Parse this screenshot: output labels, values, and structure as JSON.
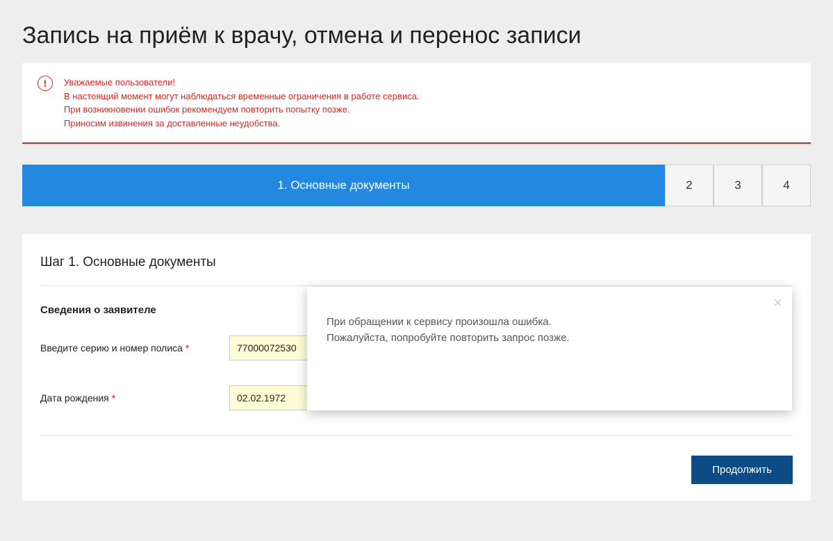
{
  "title": "Запись на приём к врачу, отмена и перенос записи",
  "warning": {
    "line1": "Уважаемые пользователи!",
    "line2": "В настоящий момент могут наблюдаться временные ограничения в работе сервиса.",
    "line3": "При возникновении ошибок рекомендуем повторить попытку позже.",
    "line4": "Приносим извинения за доставленные неудобства."
  },
  "steps": {
    "active": "1. Основные документы",
    "s2": "2",
    "s3": "3",
    "s4": "4"
  },
  "form": {
    "heading": "Шаг 1. Основные документы",
    "section_title": "Сведения о заявителе",
    "policy_label": "Введите серию и номер полиса ",
    "policy_value": "77000072530",
    "dob_label": "Дата рождения ",
    "dob_value": "02.02.1972",
    "required_mark": "*",
    "continue_label": "Продолжить"
  },
  "modal": {
    "line1": "При обращении к сервису произошла ошибка.",
    "line2": "Пожалуйста, попробуйте повторить запрос позже.",
    "close": "×"
  }
}
